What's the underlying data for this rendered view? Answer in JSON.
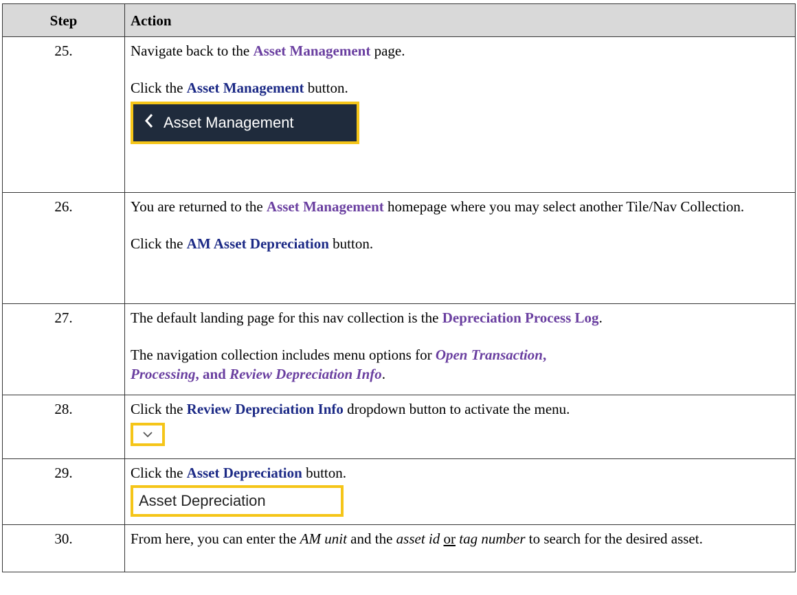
{
  "header": {
    "step": "Step",
    "action": "Action"
  },
  "rows": [
    {
      "num": "25.",
      "l1_a": "Navigate back to the ",
      "l1_b": "Asset Management",
      "l1_c": " page.",
      "l2_a": "Click the ",
      "l2_b": "Asset Management",
      "l2_c": " button.",
      "button_label": "Asset Management",
      "button_icon": "chevron-left-icon"
    },
    {
      "num": "26.",
      "l1_a": "You are returned to the ",
      "l1_b": "Asset Management",
      "l1_c": " homepage where you may select another Tile/Nav Collection.",
      "l2_a": "Click the ",
      "l2_b": "AM Asset Depreciation",
      "l2_c": " button."
    },
    {
      "num": "27.",
      "l1_a": "The default landing page for this nav collection is the ",
      "l1_b": "Depreciation Process Log",
      "l1_c": ".",
      "l2_a": "The navigation collection includes menu options for ",
      "l2_b": "Open Transaction",
      "l2_c": ", ",
      "l2_d": "Processing",
      "l2_e": ", and ",
      "l2_f": "Review Depreciation Info",
      "l2_g": "."
    },
    {
      "num": "28.",
      "l1_a": "Click the ",
      "l1_b": "Review Depreciation Info",
      "l1_c": " dropdown button to activate the menu.",
      "button_icon": "chevron-down-icon"
    },
    {
      "num": "29.",
      "l1_a": "Click the ",
      "l1_b": "Asset Depreciation",
      "l1_c": " button.",
      "button_label": "Asset Depreciation"
    },
    {
      "num": "30.",
      "l1_a": "From here, you can enter the ",
      "l1_b": "AM unit",
      "l1_c": " and the ",
      "l1_d": "asset id",
      "l1_e": " ",
      "l1_f": "or",
      "l1_g": " ",
      "l1_h": "tag number",
      "l1_i": " to search for the desired asset."
    }
  ],
  "colors": {
    "purple": "#6a3fa0",
    "navy": "#1c2a86",
    "highlight": "#f5c518",
    "dark_button": "#1f2b3c",
    "header_bg": "#d9d9d9"
  }
}
